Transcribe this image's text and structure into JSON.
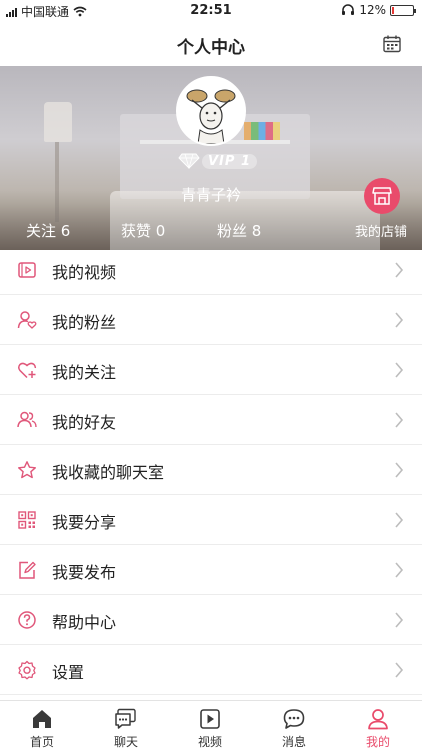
{
  "status_bar": {
    "carrier": "中国联通",
    "time": "22:51",
    "battery_percent": "12%",
    "battery_level": 0.12
  },
  "nav": {
    "title": "个人中心",
    "calendar_icon": "calendar-icon"
  },
  "profile": {
    "vip_label": "VIP 1",
    "username": "青青子衿",
    "stats": {
      "following": "关注 6",
      "likes": "获赞 0",
      "fans": "粉丝 8"
    },
    "shop_label": "我的店铺",
    "shop_icon": "storefront-icon"
  },
  "menu": {
    "items": [
      {
        "label": "我的视频",
        "icon": "video-icon"
      },
      {
        "label": "我的粉丝",
        "icon": "user-heart-icon"
      },
      {
        "label": "我的关注",
        "icon": "heart-plus-icon"
      },
      {
        "label": "我的好友",
        "icon": "friends-icon"
      },
      {
        "label": "我收藏的聊天室",
        "icon": "star-icon"
      },
      {
        "label": "我要分享",
        "icon": "qr-code-icon"
      },
      {
        "label": "我要发布",
        "icon": "edit-icon"
      },
      {
        "label": "帮助中心",
        "icon": "help-icon"
      },
      {
        "label": "设置",
        "icon": "settings-icon"
      }
    ]
  },
  "tabs": {
    "items": [
      {
        "label": "首页",
        "icon": "home-icon"
      },
      {
        "label": "聊天",
        "icon": "chat-icon"
      },
      {
        "label": "视频",
        "icon": "play-icon"
      },
      {
        "label": "消息",
        "icon": "message-icon"
      },
      {
        "label": "我的",
        "icon": "profile-icon"
      }
    ],
    "active_index": 4
  },
  "colors": {
    "accent": "#e94b6b",
    "icon_pink": "#e0577a",
    "text": "#222222",
    "divider": "#ececec"
  }
}
